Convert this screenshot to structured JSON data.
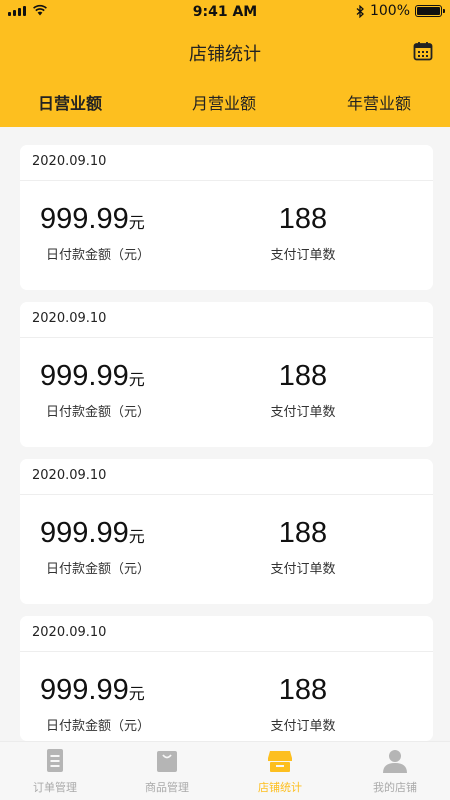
{
  "status_bar": {
    "time": "9:41 AM",
    "battery": "100%"
  },
  "nav": {
    "title": "店铺统计",
    "action_icon": "calendar-icon"
  },
  "tabs": [
    {
      "label": "日营业额",
      "active": true
    },
    {
      "label": "月营业额",
      "active": false
    },
    {
      "label": "年营业额",
      "active": false
    }
  ],
  "records": [
    {
      "date": "2020.09.10",
      "amount": "999.99",
      "amount_unit": "元",
      "amount_label": "日付款金额（元）",
      "count": "188",
      "count_label": "支付订单数"
    },
    {
      "date": "2020.09.10",
      "amount": "999.99",
      "amount_unit": "元",
      "amount_label": "日付款金额（元）",
      "count": "188",
      "count_label": "支付订单数"
    },
    {
      "date": "2020.09.10",
      "amount": "999.99",
      "amount_unit": "元",
      "amount_label": "日付款金额（元）",
      "count": "188",
      "count_label": "支付订单数"
    },
    {
      "date": "2020.09.10",
      "amount": "999.99",
      "amount_unit": "元",
      "amount_label": "日付款金额（元）",
      "count": "188",
      "count_label": "支付订单数"
    }
  ],
  "tabbar": [
    {
      "label": "订单管理",
      "icon": "order-document-icon",
      "active": false
    },
    {
      "label": "商品管理",
      "icon": "shopping-bag-icon",
      "active": false
    },
    {
      "label": "店铺统计",
      "icon": "store-icon",
      "active": true
    },
    {
      "label": "我的店铺",
      "icon": "user-icon",
      "active": false
    }
  ],
  "colors": {
    "accent": "#fdbf1f",
    "background": "#f5f5f5",
    "inactive_tab": "#aaaaaa"
  }
}
